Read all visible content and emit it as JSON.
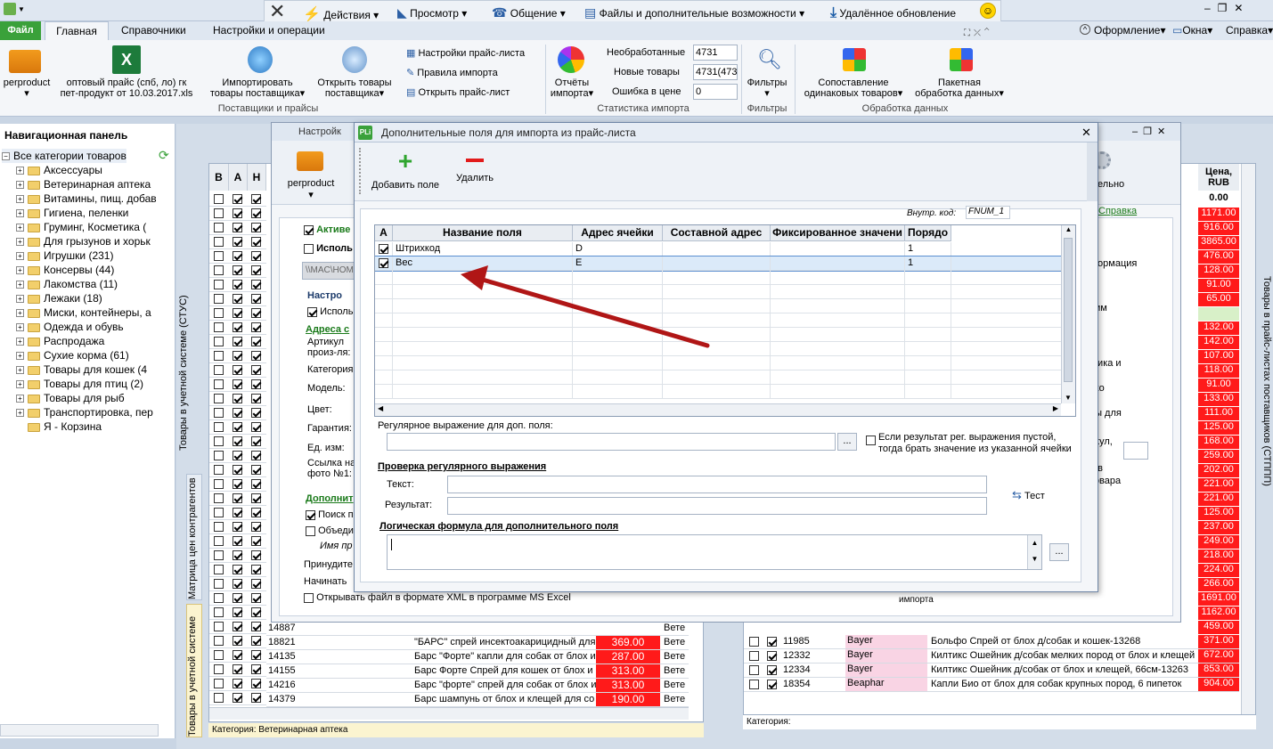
{
  "topbar": {
    "actions": "Действия",
    "view": "Просмотр",
    "comm": "Общение",
    "files": "Файлы и дополнительные возможности",
    "update": "Удалённое обновление"
  },
  "menu": {
    "file": "Файл",
    "tabs": [
      "Главная",
      "Справочники",
      "Настройки и операции"
    ],
    "design": "Оформление",
    "windows": "Окна",
    "help": "Справка"
  },
  "ribbon": {
    "perproduct": "perproduct",
    "price_file_1": "оптовый прайс (спб, ло) гк",
    "price_file_2": "пет-продукт от 10.03.2017.xls",
    "import_1": "Импортировать",
    "import_2": "товары поставщика",
    "open_1": "Открыть товары",
    "open_2": "поставщика",
    "pl_settings": "Настройки прайс-листа",
    "import_rules": "Правила импорта",
    "open_pl": "Открыть прайс-лист",
    "group_suppliers": "Поставщики и прайсы",
    "reports_1": "Отчёты",
    "reports_2": "импорта",
    "unprocessed_lbl": "Необработанные",
    "unprocessed_val": "4731",
    "new_lbl": "Новые товары",
    "new_val": "4731(473",
    "err_lbl": "Ошибка в цене",
    "err_val": "0",
    "group_stats": "Статистика импорта",
    "filters": "Фильтры",
    "group_filters": "Фильтры",
    "match_1": "Сопоставление",
    "match_2": "одинаковых товаров",
    "batch_1": "Пакетная",
    "batch_2": "обработка данных",
    "group_processing": "Обработка данных"
  },
  "nav": {
    "title": "Навигационная панель",
    "items": [
      "Все категории товаров",
      "Аксессуары",
      "Ветеринарная аптека",
      "Витамины, пищ. добав",
      "Гигиена, пеленки",
      "Груминг, Косметика (",
      "Для грызунов и хорьк",
      "Игрушки (231)",
      "Консервы (44)",
      "Лакомства (11)",
      "Лежаки (18)",
      "Миски, контейнеры, а",
      "Одежда и обувь",
      "Распродажа",
      "Сухие корма (61)",
      "Товары для кошек (4",
      "Товары для птиц (2)",
      "Товары для рыб",
      "Транспортировка, пер",
      "Я - Корзина"
    ]
  },
  "vtabs": {
    "left": "Товары в учетной системе (СТУС)",
    "matrix": "Матрица цен контрагентов",
    "acct": "Товары в учетной системе",
    "right": "Товары в прайс-листах поставщиков (СТППП)"
  },
  "leftgrid": {
    "headers": [
      "В",
      "А",
      "Н"
    ],
    "rows": [
      {
        "code": "14887",
        "name": "",
        "price": "",
        "v": "Вете"
      },
      {
        "code": "18821",
        "name": "\"БАРС\" спрей инсектоакарицидный для",
        "price": "369.00",
        "v": "Вете"
      },
      {
        "code": "14135",
        "name": "Барс \"Форте\" капли для собак от блох и",
        "price": "287.00",
        "v": "Вете"
      },
      {
        "code": "14155",
        "name": "Барс Форте Спрей для кошек от блох и",
        "price": "313.00",
        "v": "Вете"
      },
      {
        "code": "14216",
        "name": "Барс \"форте\" спрей для собак от блох и",
        "price": "313.00",
        "v": "Вете"
      },
      {
        "code": "14379",
        "name": "Барс шампунь от блох и клещей для со",
        "price": "190.00",
        "v": "Вете"
      }
    ],
    "category": "Категория: Ветеринарная аптека"
  },
  "rightgrid": {
    "header": "Цена, RUB",
    "top": "0.00",
    "prices": [
      "1171.00",
      "916.00",
      "3865.00",
      "476.00",
      "128.00",
      "91.00",
      "65.00",
      "",
      "132.00",
      "142.00",
      "107.00",
      "118.00",
      "91.00",
      "133.00",
      "111.00",
      "125.00",
      "168.00",
      "259.00",
      "202.00",
      "221.00",
      "221.00",
      "125.00",
      "237.00",
      "249.00",
      "218.00",
      "224.00",
      "266.00",
      "1691.00",
      "1162.00",
      "459.00"
    ],
    "rows": [
      {
        "code": "11985",
        "brand": "Bayer",
        "name": "Больфо Спрей от блох д/собак и кошек-13268",
        "price": "371.00"
      },
      {
        "code": "12332",
        "brand": "Bayer",
        "name": "Килтикс Ошейник д/собак мелких пород от блох и клещей",
        "price": "672.00"
      },
      {
        "code": "12334",
        "brand": "Bayer",
        "name": "Килтикс Ошейник д/собак от блох и клещей, 66см-13263",
        "price": "853.00"
      },
      {
        "code": "18354",
        "brand": "Beaphar",
        "name": "Капли Био от блох для собак крупных пород, 6 пипеток",
        "price": "904.00"
      }
    ],
    "category": "Категория:"
  },
  "settings": {
    "title": "Настройк",
    "active": "Активе",
    "use": "Исполь",
    "path": "\\\\MAC\\HOM",
    "tune": "Настро",
    "use2": "Исполь",
    "addr": "Адреса с",
    "article": "Артикул",
    "maker": "произ-ля:",
    "category": "Категория",
    "model": "Модель:",
    "color": "Цвет:",
    "warranty": "Гарантия:",
    "unit": "Ед. изм:",
    "link": "Ссылка на",
    "photo": "фото №1:",
    "extra": "Дополнит",
    "search": "Поиск п",
    "combine": "Объеди",
    "name_pr": "Имя пр",
    "force": "Принудите",
    "start": "Начинать",
    "xml": "Открывать файл в формате XML в программе MS Excel",
    "right_info": "формация",
    "right_opts": [
      "ним",
      "щика и",
      "ько",
      "ны для",
      "икул,",
      "е в",
      "товара"
    ],
    "import_lbl": "импорта",
    "right_perf": "ительно"
  },
  "dialog": {
    "title": "Дополнительные поля для импорта из прайс-листа",
    "add": "Добавить поле",
    "delete": "Удалить",
    "inner_code_lbl": "Внутр. код:",
    "inner_code": "FNUM_1",
    "help": "Справка",
    "columns": [
      "А",
      "Название поля",
      "Адрес ячейки",
      "Составной адрес",
      "Фиксированное значени",
      "Порядо"
    ],
    "rows": [
      {
        "checked": true,
        "name": "Штрихкод",
        "addr": "D",
        "comp": "",
        "fixed": "",
        "order": "1"
      },
      {
        "checked": true,
        "name": "Вес",
        "addr": "E",
        "comp": "",
        "fixed": "",
        "order": "1"
      }
    ],
    "regex_lbl": "Регулярное выражение для доп. поля:",
    "regex_val": "",
    "empty_opt_1": "Если результат рег. выражения пустой,",
    "empty_opt_2": "тогда брать значение из указанной ячейки",
    "check_lbl": "Проверка регулярного выражения",
    "text_lbl": "Текст:",
    "result_lbl": "Результат:",
    "test": "Тест",
    "formula_lbl": "Логическая формула для дополнительного поля",
    "dots": "..."
  },
  "colors": {
    "accent": "#1f6fc3",
    "price_red": "#ff1a1a",
    "arrow": "#b01616",
    "link": "#1a7a1a"
  }
}
